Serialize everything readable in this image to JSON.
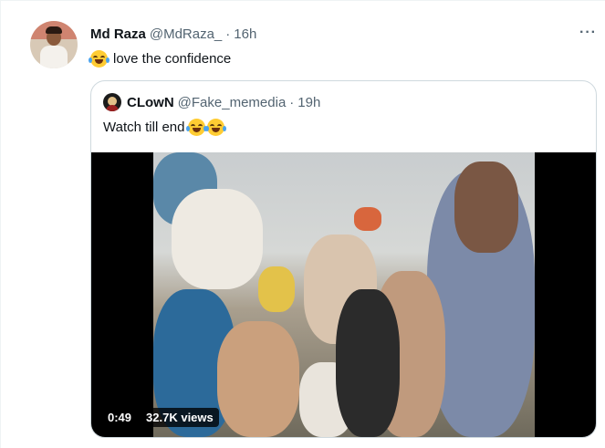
{
  "tweet": {
    "name": "Md Raza",
    "handle": "@MdRaza_",
    "separator": "·",
    "time": "16h",
    "more": "···",
    "text": "love the confidence",
    "emoji": "joy-emoji"
  },
  "quote": {
    "name": "CLowN",
    "handle": "@Fake_memedia",
    "separator": "·",
    "time": "19h",
    "text": "Watch till end",
    "emojis": [
      "joy-emoji",
      "joy-emoji"
    ]
  },
  "video": {
    "duration": "0:49",
    "views": "32.7K views"
  },
  "colors": {
    "text": "#0f1419",
    "secondary": "#536471",
    "border": "#cfd9de"
  }
}
